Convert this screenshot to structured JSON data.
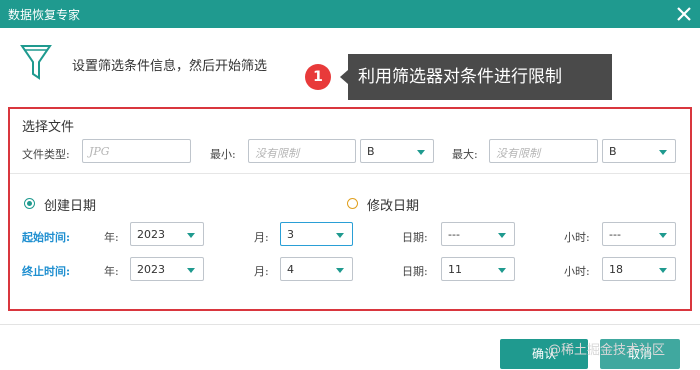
{
  "window": {
    "title": "数据恢复专家"
  },
  "header": {
    "text": "设置筛选条件信息，然后开始筛选"
  },
  "callout": {
    "number": "1",
    "text": "利用筛选器对条件进行限制"
  },
  "file_section": {
    "title": "选择文件",
    "type_label": "文件类型:",
    "type_placeholder": "JPG",
    "min_label": "最小:",
    "min_placeholder": "没有限制",
    "min_unit": "B",
    "max_label": "最大:",
    "max_placeholder": "没有限制",
    "max_unit": "B"
  },
  "date_section": {
    "created_label": "创建日期",
    "modified_label": "修改日期",
    "selected": "created",
    "start": {
      "label": "起始时间:",
      "year_label": "年:",
      "year": "2023",
      "month_label": "月:",
      "month": "3",
      "day_label": "日期:",
      "day": "---",
      "hour_label": "小时:",
      "hour": "---"
    },
    "end": {
      "label": "终止时间:",
      "year_label": "年:",
      "year": "2023",
      "month_label": "月:",
      "month": "4",
      "day_label": "日期:",
      "day": "11",
      "hour_label": "小时:",
      "hour": "18"
    }
  },
  "footer": {
    "confirm": "确认",
    "cancel": "取消"
  },
  "watermark": "@稀土掘金技术社区",
  "colors": {
    "accent": "#1f9a8f",
    "highlight": "#d9363e",
    "label_blue": "#1f8fd0"
  }
}
